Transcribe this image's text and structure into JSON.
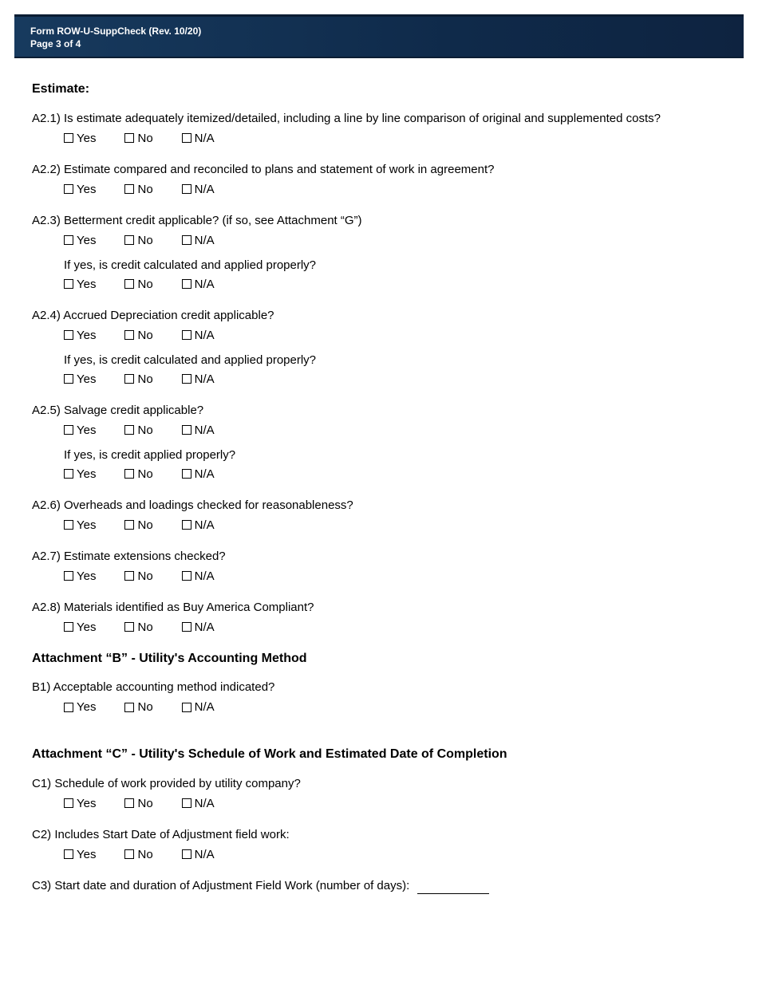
{
  "header": {
    "form": "Form ROW-U-SuppCheck  (Rev. 10/20)",
    "page": "Page 3 of 4"
  },
  "labels": {
    "yes": "Yes",
    "no": "No",
    "na": "N/A"
  },
  "estimate": {
    "title": "Estimate:",
    "a21": "A2.1) Is estimate adequately itemized/detailed, including a line by line comparison of original and supplemented costs?",
    "a22": "A2.2) Estimate compared and reconciled to plans and statement of work in agreement?",
    "a23": "A2.3) Betterment credit applicable?  (if so, see Attachment “G”)",
    "a23_sub": "If yes, is credit calculated and applied properly?",
    "a24": "A2.4) Accrued Depreciation credit applicable?",
    "a24_sub": "If yes, is credit calculated and applied properly?",
    "a25": "A2.5) Salvage credit applicable?",
    "a25_sub": "If yes, is credit applied properly?",
    "a26": "A2.6) Overheads and loadings checked for reasonableness?",
    "a27": "A2.7) Estimate extensions checked?",
    "a28": "A2.8) Materials identified as Buy America Compliant?"
  },
  "attB": {
    "title": "Attachment “B” - Utility's Accounting Method",
    "b1": "B1) Acceptable accounting method indicated?"
  },
  "attC": {
    "title": "Attachment “C” - Utility's Schedule of Work and Estimated Date of Completion",
    "c1": "C1) Schedule of work provided by utility company?",
    "c2": "C2) Includes Start Date of Adjustment field work:",
    "c3": "C3) Start date and duration of Adjustment Field Work (number of days):"
  }
}
